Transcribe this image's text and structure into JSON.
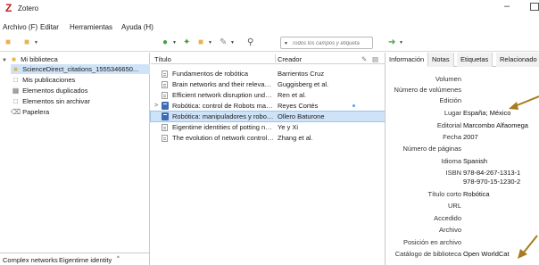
{
  "window": {
    "title": "Zotero",
    "logo": "Z",
    "minimize": "–"
  },
  "menu": [
    "Archivo (F)",
    "Editar",
    "Herramientas",
    "Ayuda (H)"
  ],
  "search": {
    "placeholder": "Todos los campos y etiqueta"
  },
  "colors": {
    "accent": "#3e6cb3",
    "selected_row": "#cfe3f8",
    "folder": "#e8b450",
    "arrow": "#a67c1e",
    "logo": "#c8161d"
  },
  "toolbar_icons": [
    "new-collection-icon",
    "new-library-icon",
    "sync-icon",
    "new-item-icon",
    "magic-wand-icon",
    "add-attachment-icon",
    "add-note-icon",
    "search-icon",
    "locate-icon"
  ],
  "library": {
    "root": "Mi biblioteca",
    "items": [
      "ScienceDirect_citations_1555346650...",
      "Mis publicaciones",
      "Elementos duplicados",
      "Elementos sin archivar",
      "Papelera"
    ]
  },
  "tags": [
    "Complex networks",
    "Eigentime identity"
  ],
  "columns": {
    "title": "Título",
    "creator": "Creador"
  },
  "items": [
    {
      "title": "Fundamentos de robótica",
      "creator": "Barrientos Cruz",
      "icon": "document-icon"
    },
    {
      "title": "Brain networks and their relevance for ...",
      "creator": "Guggisberg et al.",
      "icon": "document-icon"
    },
    {
      "title": "Efficient network disruption under imp...",
      "creator": "Ren et al.",
      "icon": "document-icon"
    },
    {
      "title": "Robótica: control de Robots manipula...",
      "creator": "Reyes Cortés",
      "icon": "book-icon"
    },
    {
      "title": "Robótica: manipuladores y robots mó...",
      "creator": "Ollero Baturone",
      "icon": "book-icon"
    },
    {
      "title": "Eigentime identities of potting networks ...",
      "creator": "Ye y Xi",
      "icon": "document-icon"
    },
    {
      "title": "The evolution of network controllabilit...",
      "creator": "Zhang et al.",
      "icon": "document-icon"
    }
  ],
  "tabs": [
    "Información",
    "Notas",
    "Etiquetas",
    "Relacionado"
  ],
  "fields": [
    {
      "label": "Volumen",
      "value": ""
    },
    {
      "label": "Número de volúmenes",
      "value": ""
    },
    {
      "label": "Edición",
      "value": ""
    },
    {
      "label": "Lugar",
      "value": "España; México"
    },
    {
      "label": "Editorial",
      "value": "Marcombo Alfaomega"
    },
    {
      "label": "Fecha",
      "value": "2007"
    },
    {
      "label": "Número de páginas",
      "value": ""
    },
    {
      "label": "Idioma",
      "value": "Spanish"
    },
    {
      "label": "ISBN",
      "value": "978-84-267-1313-1"
    },
    {
      "label": "",
      "value": "978-970-15-1230-2"
    },
    {
      "label": "Título corto",
      "value": "Robótica"
    },
    {
      "label": "URL",
      "value": ""
    },
    {
      "label": "Accedido",
      "value": ""
    },
    {
      "label": "Archivo",
      "value": ""
    },
    {
      "label": "Posición en archivo",
      "value": ""
    },
    {
      "label": "Catálogo de biblioteca",
      "value": "Open WorldCat"
    }
  ]
}
